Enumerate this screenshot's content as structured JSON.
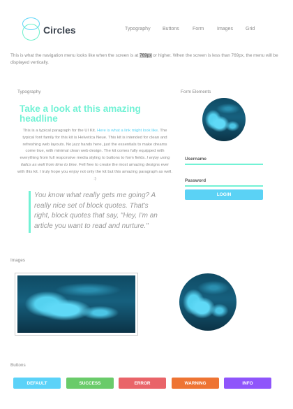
{
  "brand": {
    "name": "Circles"
  },
  "nav": [
    "Typography",
    "Buttons",
    "Form",
    "Images",
    "Grid"
  ],
  "intro": {
    "before": "This is what the navigation menu looks like when the screen is at ",
    "highlight": "769px",
    "after": " or higher. When the screen is less than 769px, the menu will be displayed vertically."
  },
  "typography": {
    "label": "Typography",
    "headline": "Take a look at this amazing headline",
    "p1": "This is a typical paragraph for the UI Kit. ",
    "link": "Here is what a link might look like",
    "p2": ". The typical font family for this kit is Helvetica Neue. This kit is intended for clean and refreshing web layouts. No jazz hands here, just the essentials to make dreams come true, with minimal clean web design. The kit comes fully equipped with everything from full responsive media styling to buttons to form fields. ",
    "italic": "I enjoy using italics as well from time to time.",
    "p3": " Fell free to create the most amazing designs ever with this kit. I truly hope you enjoy not only the kit but this amazing paragraph as well. :)",
    "quote": "You know what really gets me going? A really nice set of block quotes. That's right, block quotes that say, \"Hey, I'm an article you want to read and nurture.\""
  },
  "form": {
    "label": "Form Elements",
    "username": "Username",
    "password": "Password",
    "login": "LOGIN"
  },
  "images": {
    "label": "Images"
  },
  "buttons": {
    "label": "Buttons",
    "items": [
      {
        "label": "DEFAULT",
        "color": "#5bd2f8"
      },
      {
        "label": "SUCCESS",
        "color": "#6acb6a"
      },
      {
        "label": "ERROR",
        "color": "#e96469"
      },
      {
        "label": "WARNING",
        "color": "#ee7433"
      },
      {
        "label": "INFO",
        "color": "#8f55fb"
      }
    ]
  }
}
